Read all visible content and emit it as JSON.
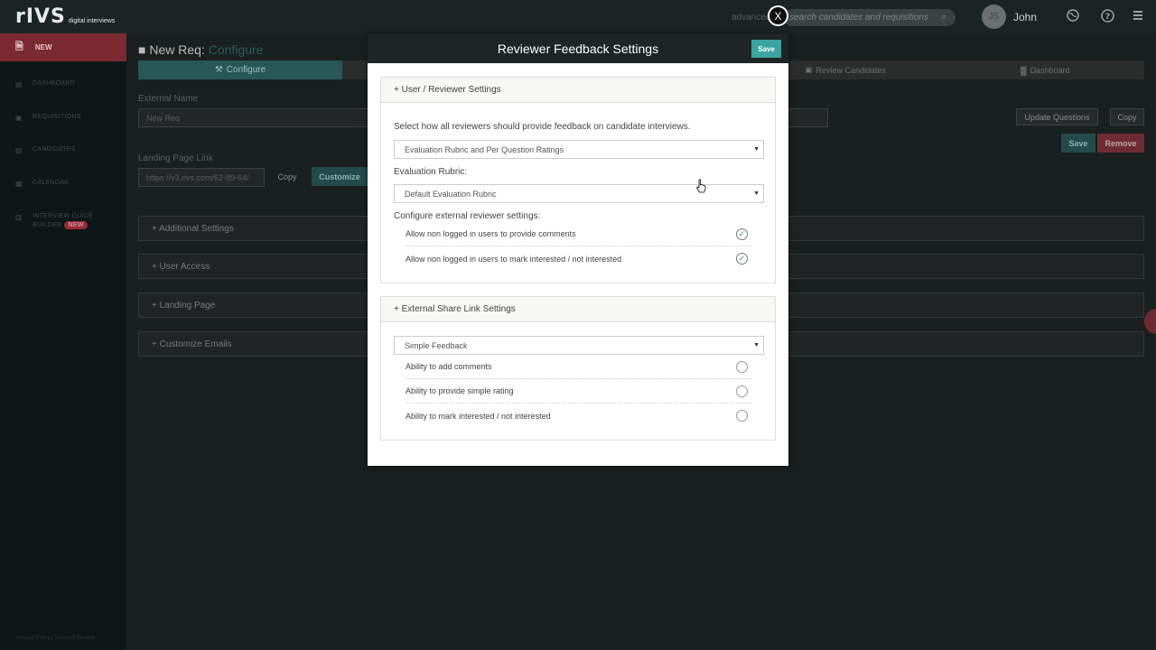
{
  "topbar": {
    "logo_main": "rIVS",
    "logo_sub": "digital interviews",
    "advanced_label": "advanced",
    "search_placeholder": "search candidates and requisitions",
    "user_initials": "JS",
    "user_name": "John",
    "close_label": "X"
  },
  "sidebar": {
    "new_label": "NEW",
    "items": [
      {
        "label": "DASHBOARD"
      },
      {
        "label": "REQUISITIONS"
      },
      {
        "label": "CANDIDATES"
      },
      {
        "label": "CALENDAR"
      },
      {
        "label_line1": "INTERVIEW GUIDE",
        "label_line2": "BUILDER",
        "badge": "NEW"
      }
    ],
    "footer": "Privacy Policy | Terms of Service"
  },
  "main": {
    "title_prefix": "New Req:",
    "title_accent": "Configure",
    "steps": {
      "configure": "Configure",
      "review": "Review Candidates",
      "dashboard": "Dashboard"
    },
    "external_name_label": "External Name",
    "external_name_value": "New Req",
    "landing_link_label": "Landing Page Link",
    "landing_link_value": "https://v3.rivs.com/62-89-64/",
    "copy_label": "Copy",
    "customize_label": "Customize",
    "update_questions_label": "Update Questions",
    "copy2_label": "Copy",
    "save_label": "Save",
    "remove_label": "Remove",
    "panels": [
      "+ Additional Settings",
      "+ User Access",
      "+ Landing Page",
      "+ Customize Emails"
    ]
  },
  "modal": {
    "title": "Reviewer Feedback Settings",
    "save_label": "Save",
    "user_section": {
      "heading": "+ User / Reviewer Settings",
      "description": "Select how all reviewers should provide feedback on candidate interviews.",
      "feedback_select": "Evaluation Rubric and Per Question Ratings",
      "rubric_label": "Evaluation Rubric:",
      "rubric_select": "Default Evaluation Rubric",
      "external_label": "Configure external reviewer settings:",
      "options": [
        {
          "label": "Allow non logged in users to provide comments",
          "checked": true
        },
        {
          "label": "Allow non logged in users to mark interested / not interested",
          "checked": true
        }
      ]
    },
    "share_section": {
      "heading": "+ External Share Link Settings",
      "select": "Simple Feedback",
      "options": [
        {
          "label": "Ability to add comments",
          "checked": false
        },
        {
          "label": "Ability to provide simple rating",
          "checked": false
        },
        {
          "label": "Ability to mark interested / not interested",
          "checked": false
        }
      ]
    }
  }
}
